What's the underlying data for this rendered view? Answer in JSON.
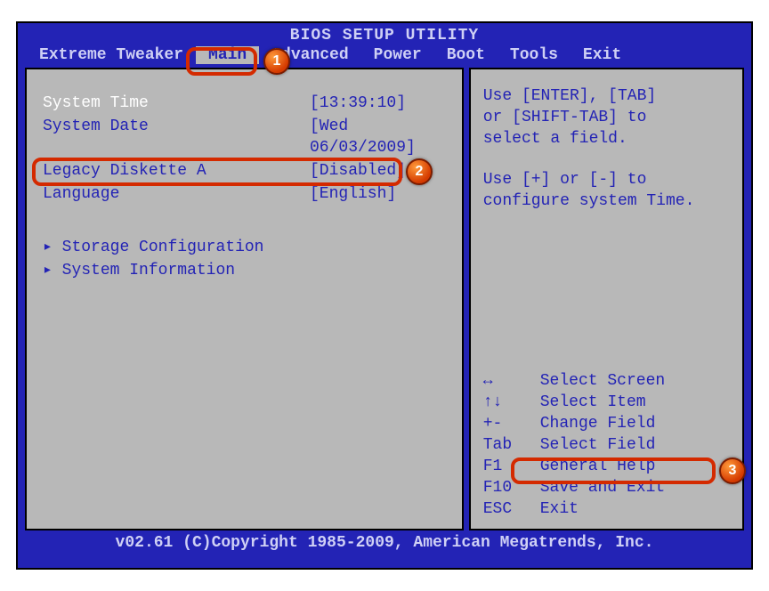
{
  "title": "BIOS SETUP UTILITY",
  "menu": {
    "items": [
      {
        "label": "Extreme Tweaker",
        "active": false
      },
      {
        "label": "Main",
        "active": true
      },
      {
        "label": "Advanced",
        "active": false
      },
      {
        "label": "Power",
        "active": false
      },
      {
        "label": "Boot",
        "active": false
      },
      {
        "label": "Tools",
        "active": false
      },
      {
        "label": "Exit",
        "active": false
      }
    ]
  },
  "main": {
    "system_time": {
      "label": "System Time",
      "value": "[13:39:10]"
    },
    "system_date": {
      "label": "System Date",
      "value": "[Wed 06/03/2009]"
    },
    "legacy_diskette": {
      "label": "Legacy Diskette A",
      "value": "[Disabled]"
    },
    "language": {
      "label": "Language",
      "value": "[English]"
    },
    "storage_config": {
      "label": "Storage Configuration"
    },
    "system_info": {
      "label": "System Information"
    }
  },
  "help": {
    "top1": "Use [ENTER], [TAB]",
    "top2": "or [SHIFT-TAB] to",
    "top3": "select a field.",
    "top4": "Use [+] or [-] to",
    "top5": "configure system Time.",
    "keys": {
      "k1": {
        "key": "↔",
        "desc": "Select Screen"
      },
      "k2": {
        "key": "↑↓",
        "desc": "Select Item"
      },
      "k3": {
        "key": "+-",
        "desc": "Change Field"
      },
      "k4": {
        "key": "Tab",
        "desc": "Select Field"
      },
      "k5": {
        "key": "F1",
        "desc": "General Help"
      },
      "k6": {
        "key": "F10",
        "desc": "Save and Exit"
      },
      "k7": {
        "key": "ESC",
        "desc": "Exit"
      }
    }
  },
  "footer": "v02.61 (C)Copyright 1985-2009, American Megatrends, Inc.",
  "annotations": {
    "b1": "1",
    "b2": "2",
    "b3": "3"
  }
}
